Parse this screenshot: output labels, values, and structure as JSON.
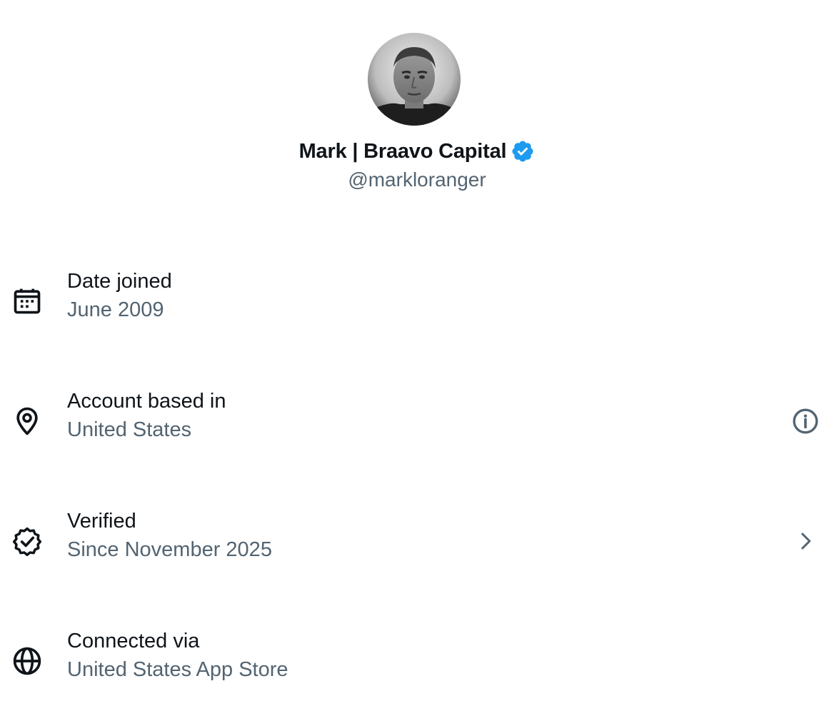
{
  "profile": {
    "display_name": "Mark | Braavo Capital",
    "handle": "@markloranger",
    "verified": true,
    "badge_color": "#1d9bf0"
  },
  "details": [
    {
      "icon": "calendar-icon",
      "label": "Date joined",
      "value": "June 2009"
    },
    {
      "icon": "location-pin-icon",
      "label": "Account based in",
      "value": "United States",
      "trailing_icon": "info-icon"
    },
    {
      "icon": "verified-check-icon",
      "label": "Verified",
      "value": "Since November 2025",
      "trailing_icon": "chevron-right-icon"
    },
    {
      "icon": "globe-icon",
      "label": "Connected via",
      "value": "United States App Store"
    }
  ],
  "colors": {
    "primary_text": "#0f1419",
    "secondary_text": "#536471",
    "background": "#ffffff"
  }
}
